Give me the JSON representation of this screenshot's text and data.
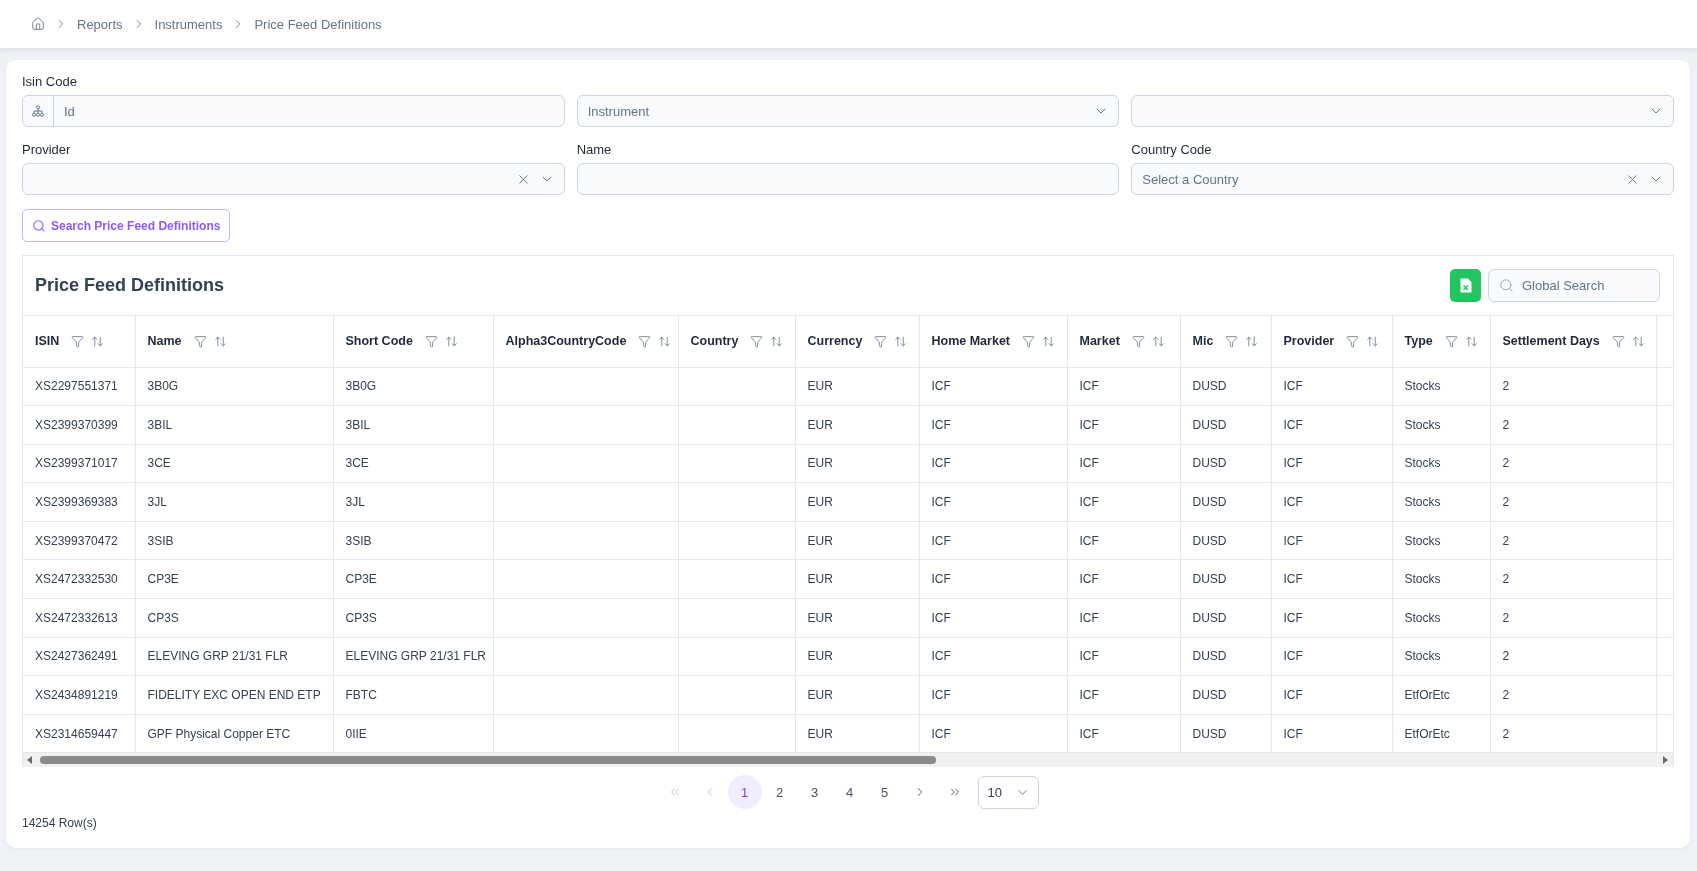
{
  "breadcrumb": {
    "items": [
      {
        "label": "Reports"
      },
      {
        "label": "Instruments"
      },
      {
        "label": "Price Feed Definitions"
      }
    ]
  },
  "filters": [
    {
      "kind": "prefixed_text",
      "label": "Isin Code",
      "placeholder": "Id"
    },
    {
      "kind": "select",
      "placeholder": "Instrument",
      "clearable": false
    },
    {
      "kind": "select",
      "clearable": false
    },
    {
      "kind": "select",
      "label": "Provider",
      "clearable": true
    },
    {
      "kind": "text",
      "label": "Name"
    },
    {
      "kind": "select",
      "label": "Country Code",
      "placeholder": "Select a Country",
      "clearable": true
    }
  ],
  "search_button": {
    "label": "Search Price Feed Definitions"
  },
  "table": {
    "title": "Price Feed Definitions",
    "global_search": {
      "placeholder": "Global Search"
    },
    "columns": [
      {
        "label": "ISIN"
      },
      {
        "label": "Name"
      },
      {
        "label": "Short Code"
      },
      {
        "label": "Alpha3CountryCode"
      },
      {
        "label": "Country"
      },
      {
        "label": "Currency"
      },
      {
        "label": "Home Market"
      },
      {
        "label": "Market"
      },
      {
        "label": "Mic"
      },
      {
        "label": "Provider"
      },
      {
        "label": "Type"
      },
      {
        "label": "Settlement Days"
      }
    ],
    "rows": [
      {
        "isin": "XS2297551371",
        "name": "3B0G",
        "short_code": "3B0G",
        "currency": "EUR",
        "home_market": "ICF",
        "market": "ICF",
        "mic": "DUSD",
        "provider": "ICF",
        "type": "Stocks",
        "settlement_days": "2"
      },
      {
        "isin": "XS2399370399",
        "name": "3BIL",
        "short_code": "3BIL",
        "currency": "EUR",
        "home_market": "ICF",
        "market": "ICF",
        "mic": "DUSD",
        "provider": "ICF",
        "type": "Stocks",
        "settlement_days": "2"
      },
      {
        "isin": "XS2399371017",
        "name": "3CE",
        "short_code": "3CE",
        "currency": "EUR",
        "home_market": "ICF",
        "market": "ICF",
        "mic": "DUSD",
        "provider": "ICF",
        "type": "Stocks",
        "settlement_days": "2"
      },
      {
        "isin": "XS2399369383",
        "name": "3JL",
        "short_code": "3JL",
        "currency": "EUR",
        "home_market": "ICF",
        "market": "ICF",
        "mic": "DUSD",
        "provider": "ICF",
        "type": "Stocks",
        "settlement_days": "2"
      },
      {
        "isin": "XS2399370472",
        "name": "3SIB",
        "short_code": "3SIB",
        "currency": "EUR",
        "home_market": "ICF",
        "market": "ICF",
        "mic": "DUSD",
        "provider": "ICF",
        "type": "Stocks",
        "settlement_days": "2"
      },
      {
        "isin": "XS2472332530",
        "name": "CP3E",
        "short_code": "CP3E",
        "currency": "EUR",
        "home_market": "ICF",
        "market": "ICF",
        "mic": "DUSD",
        "provider": "ICF",
        "type": "Stocks",
        "settlement_days": "2"
      },
      {
        "isin": "XS2472332613",
        "name": "CP3S",
        "short_code": "CP3S",
        "currency": "EUR",
        "home_market": "ICF",
        "market": "ICF",
        "mic": "DUSD",
        "provider": "ICF",
        "type": "Stocks",
        "settlement_days": "2"
      },
      {
        "isin": "XS2427362491",
        "name": "ELEVING GRP 21/31 FLR",
        "short_code": "ELEVING GRP 21/31 FLR",
        "currency": "EUR",
        "home_market": "ICF",
        "market": "ICF",
        "mic": "DUSD",
        "provider": "ICF",
        "type": "Stocks",
        "settlement_days": "2"
      },
      {
        "isin": "XS2434891219",
        "name": "FIDELITY EXC OPEN END ETP",
        "short_code": "FBTC",
        "currency": "EUR",
        "home_market": "ICF",
        "market": "ICF",
        "mic": "DUSD",
        "provider": "ICF",
        "type": "EtfOrEtc",
        "settlement_days": "2"
      },
      {
        "isin": "XS2314659447",
        "name": "GPF Physical Copper ETC",
        "short_code": "0IIE",
        "currency": "EUR",
        "home_market": "ICF",
        "market": "ICF",
        "mic": "DUSD",
        "provider": "ICF",
        "type": "EtfOrEtc",
        "settlement_days": "2"
      }
    ]
  },
  "pagination": {
    "first": {
      "disabled": true
    },
    "previous": {
      "disabled": true
    },
    "pages": [
      {
        "label": "1",
        "selected": true
      },
      {
        "label": "2",
        "selected": false
      },
      {
        "label": "3",
        "selected": false
      },
      {
        "label": "4",
        "selected": false
      },
      {
        "label": "5",
        "selected": false
      }
    ],
    "next": {
      "disabled": false
    },
    "last": {
      "disabled": false
    },
    "page_size": "10"
  },
  "row_count": "14254 Row(s)"
}
